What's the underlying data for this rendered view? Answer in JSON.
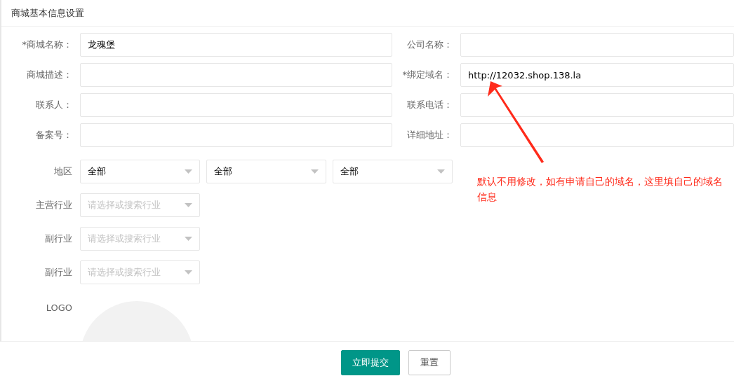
{
  "panel": {
    "title": "商城基本信息设置"
  },
  "rows": [
    {
      "left": {
        "label": "*商城名称：",
        "value": "龙魂堡"
      },
      "right": {
        "label": "公司名称："
      }
    },
    {
      "left": {
        "label": "商城描述："
      },
      "right": {
        "label": "*绑定域名：",
        "value": "http://12032.shop.138.la"
      }
    },
    {
      "left": {
        "label": "联系人："
      },
      "right": {
        "label": "联系电话："
      }
    },
    {
      "left": {
        "label": "备案号："
      },
      "right": {
        "label": "详细地址："
      }
    }
  ],
  "region": {
    "label": "地区",
    "selects": [
      {
        "value": "全部"
      },
      {
        "value": "全部"
      },
      {
        "value": "全部"
      }
    ]
  },
  "industries": [
    {
      "label": "主营行业",
      "placeholder": "请选择或搜索行业"
    },
    {
      "label": "副行业",
      "placeholder": "请选择或搜索行业"
    },
    {
      "label": "副行业",
      "placeholder": "请选择或搜索行业"
    }
  ],
  "logo": {
    "label": "LOGO"
  },
  "buttons": [
    {
      "label": "立即提交",
      "kind": "primary"
    },
    {
      "label": "重置",
      "kind": "default"
    }
  ],
  "annotation": {
    "text": "默认不用修改，如有申请自己的域名，这里填自己的域名信息"
  }
}
